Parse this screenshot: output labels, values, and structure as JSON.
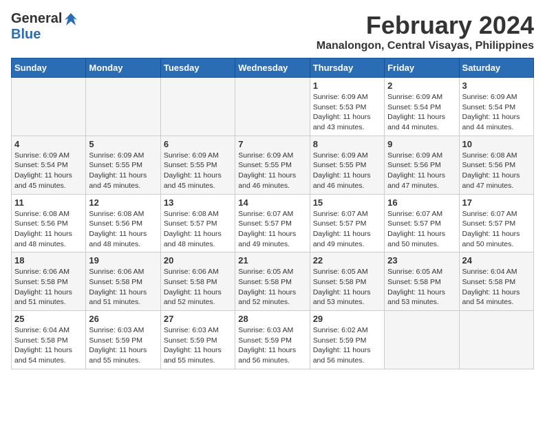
{
  "logo": {
    "general": "General",
    "blue": "Blue"
  },
  "title": {
    "month": "February 2024",
    "location": "Manalongon, Central Visayas, Philippines"
  },
  "days_of_week": [
    "Sunday",
    "Monday",
    "Tuesday",
    "Wednesday",
    "Thursday",
    "Friday",
    "Saturday"
  ],
  "weeks": [
    [
      {
        "day": "",
        "info": ""
      },
      {
        "day": "",
        "info": ""
      },
      {
        "day": "",
        "info": ""
      },
      {
        "day": "",
        "info": ""
      },
      {
        "day": "1",
        "info": "Sunrise: 6:09 AM\nSunset: 5:53 PM\nDaylight: 11 hours and 43 minutes."
      },
      {
        "day": "2",
        "info": "Sunrise: 6:09 AM\nSunset: 5:54 PM\nDaylight: 11 hours and 44 minutes."
      },
      {
        "day": "3",
        "info": "Sunrise: 6:09 AM\nSunset: 5:54 PM\nDaylight: 11 hours and 44 minutes."
      }
    ],
    [
      {
        "day": "4",
        "info": "Sunrise: 6:09 AM\nSunset: 5:54 PM\nDaylight: 11 hours and 45 minutes."
      },
      {
        "day": "5",
        "info": "Sunrise: 6:09 AM\nSunset: 5:55 PM\nDaylight: 11 hours and 45 minutes."
      },
      {
        "day": "6",
        "info": "Sunrise: 6:09 AM\nSunset: 5:55 PM\nDaylight: 11 hours and 45 minutes."
      },
      {
        "day": "7",
        "info": "Sunrise: 6:09 AM\nSunset: 5:55 PM\nDaylight: 11 hours and 46 minutes."
      },
      {
        "day": "8",
        "info": "Sunrise: 6:09 AM\nSunset: 5:55 PM\nDaylight: 11 hours and 46 minutes."
      },
      {
        "day": "9",
        "info": "Sunrise: 6:09 AM\nSunset: 5:56 PM\nDaylight: 11 hours and 47 minutes."
      },
      {
        "day": "10",
        "info": "Sunrise: 6:08 AM\nSunset: 5:56 PM\nDaylight: 11 hours and 47 minutes."
      }
    ],
    [
      {
        "day": "11",
        "info": "Sunrise: 6:08 AM\nSunset: 5:56 PM\nDaylight: 11 hours and 48 minutes."
      },
      {
        "day": "12",
        "info": "Sunrise: 6:08 AM\nSunset: 5:56 PM\nDaylight: 11 hours and 48 minutes."
      },
      {
        "day": "13",
        "info": "Sunrise: 6:08 AM\nSunset: 5:57 PM\nDaylight: 11 hours and 48 minutes."
      },
      {
        "day": "14",
        "info": "Sunrise: 6:07 AM\nSunset: 5:57 PM\nDaylight: 11 hours and 49 minutes."
      },
      {
        "day": "15",
        "info": "Sunrise: 6:07 AM\nSunset: 5:57 PM\nDaylight: 11 hours and 49 minutes."
      },
      {
        "day": "16",
        "info": "Sunrise: 6:07 AM\nSunset: 5:57 PM\nDaylight: 11 hours and 50 minutes."
      },
      {
        "day": "17",
        "info": "Sunrise: 6:07 AM\nSunset: 5:57 PM\nDaylight: 11 hours and 50 minutes."
      }
    ],
    [
      {
        "day": "18",
        "info": "Sunrise: 6:06 AM\nSunset: 5:58 PM\nDaylight: 11 hours and 51 minutes."
      },
      {
        "day": "19",
        "info": "Sunrise: 6:06 AM\nSunset: 5:58 PM\nDaylight: 11 hours and 51 minutes."
      },
      {
        "day": "20",
        "info": "Sunrise: 6:06 AM\nSunset: 5:58 PM\nDaylight: 11 hours and 52 minutes."
      },
      {
        "day": "21",
        "info": "Sunrise: 6:05 AM\nSunset: 5:58 PM\nDaylight: 11 hours and 52 minutes."
      },
      {
        "day": "22",
        "info": "Sunrise: 6:05 AM\nSunset: 5:58 PM\nDaylight: 11 hours and 53 minutes."
      },
      {
        "day": "23",
        "info": "Sunrise: 6:05 AM\nSunset: 5:58 PM\nDaylight: 11 hours and 53 minutes."
      },
      {
        "day": "24",
        "info": "Sunrise: 6:04 AM\nSunset: 5:58 PM\nDaylight: 11 hours and 54 minutes."
      }
    ],
    [
      {
        "day": "25",
        "info": "Sunrise: 6:04 AM\nSunset: 5:58 PM\nDaylight: 11 hours and 54 minutes."
      },
      {
        "day": "26",
        "info": "Sunrise: 6:03 AM\nSunset: 5:59 PM\nDaylight: 11 hours and 55 minutes."
      },
      {
        "day": "27",
        "info": "Sunrise: 6:03 AM\nSunset: 5:59 PM\nDaylight: 11 hours and 55 minutes."
      },
      {
        "day": "28",
        "info": "Sunrise: 6:03 AM\nSunset: 5:59 PM\nDaylight: 11 hours and 56 minutes."
      },
      {
        "day": "29",
        "info": "Sunrise: 6:02 AM\nSunset: 5:59 PM\nDaylight: 11 hours and 56 minutes."
      },
      {
        "day": "",
        "info": ""
      },
      {
        "day": "",
        "info": ""
      }
    ]
  ]
}
